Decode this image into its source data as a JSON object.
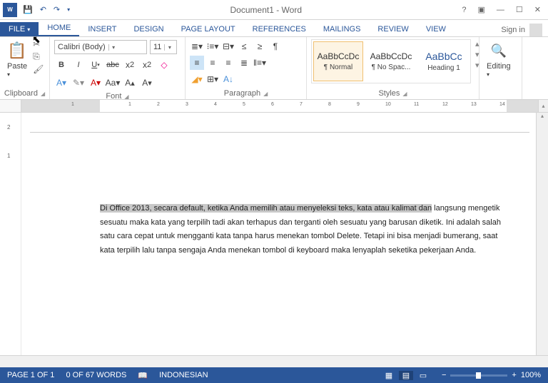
{
  "title": "Document1 - Word",
  "tabs": {
    "file": "FILE",
    "home": "HOME",
    "insert": "INSERT",
    "design": "DESIGN",
    "page_layout": "PAGE LAYOUT",
    "references": "REFERENCES",
    "mailings": "MAILINGS",
    "review": "REVIEW",
    "view": "VIEW"
  },
  "signin": "Sign in",
  "ribbon": {
    "clipboard": {
      "paste": "Paste",
      "label": "Clipboard"
    },
    "font": {
      "name": "Calibri (Body)",
      "size": "11",
      "label": "Font"
    },
    "paragraph": {
      "label": "Paragraph"
    },
    "styles": {
      "label": "Styles",
      "preview_text": "AaBbCcDc",
      "preview_heading": "AaBbCc",
      "items": [
        {
          "name": "¶ Normal"
        },
        {
          "name": "¶ No Spac..."
        },
        {
          "name": "Heading 1"
        }
      ]
    },
    "editing": {
      "label": "Editing"
    }
  },
  "document": {
    "selected": "Di Office 2013, secara default, ketika Anda memilih atau menyeleksi teks, kata atau kalimat dan",
    "rest": " langsung mengetik sesuatu maka kata yang terpilih tadi akan terhapus dan terganti oleh sesuatu yang barusan diketik. Ini adalah salah satu cara cepat untuk mengganti kata tanpa harus menekan tombol Delete. Tetapi ini bisa menjadi bumerang, saat kata terpilih lalu tanpa sengaja Anda menekan tombol di keyboard maka lenyaplah seketika pekerjaan Anda."
  },
  "status": {
    "page": "PAGE 1 OF 1",
    "words": "0 OF 67 WORDS",
    "lang": "INDONESIAN",
    "zoom": "100%"
  }
}
